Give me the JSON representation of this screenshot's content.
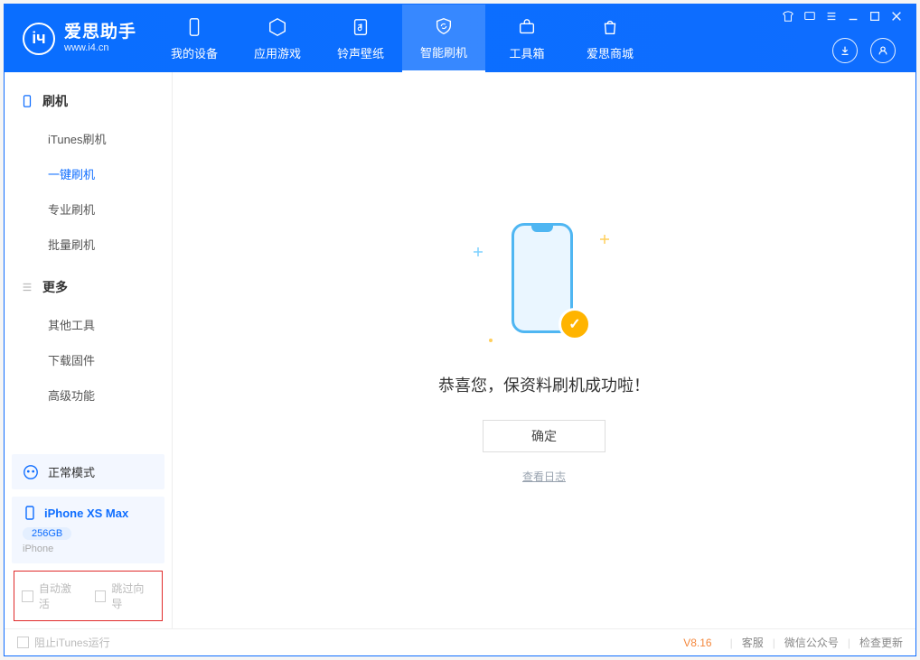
{
  "app": {
    "title": "爱思助手",
    "url": "www.i4.cn"
  },
  "nav": {
    "items": [
      {
        "label": "我的设备"
      },
      {
        "label": "应用游戏"
      },
      {
        "label": "铃声壁纸"
      },
      {
        "label": "智能刷机"
      },
      {
        "label": "工具箱"
      },
      {
        "label": "爱思商城"
      }
    ],
    "active_index": 3
  },
  "sidebar": {
    "section1_title": "刷机",
    "section1_items": [
      "iTunes刷机",
      "一键刷机",
      "专业刷机",
      "批量刷机"
    ],
    "section1_active_index": 1,
    "section2_title": "更多",
    "section2_items": [
      "其他工具",
      "下载固件",
      "高级功能"
    ],
    "mode_label": "正常模式",
    "device": {
      "name": "iPhone XS Max",
      "capacity": "256GB",
      "type": "iPhone"
    },
    "checkbox1_label": "自动激活",
    "checkbox2_label": "跳过向导"
  },
  "main": {
    "success_message": "恭喜您，保资料刷机成功啦！",
    "ok_button": "确定",
    "log_link": "查看日志"
  },
  "footer": {
    "stop_itunes": "阻止iTunes运行",
    "version": "V8.16",
    "links": [
      "客服",
      "微信公众号",
      "检查更新"
    ]
  }
}
